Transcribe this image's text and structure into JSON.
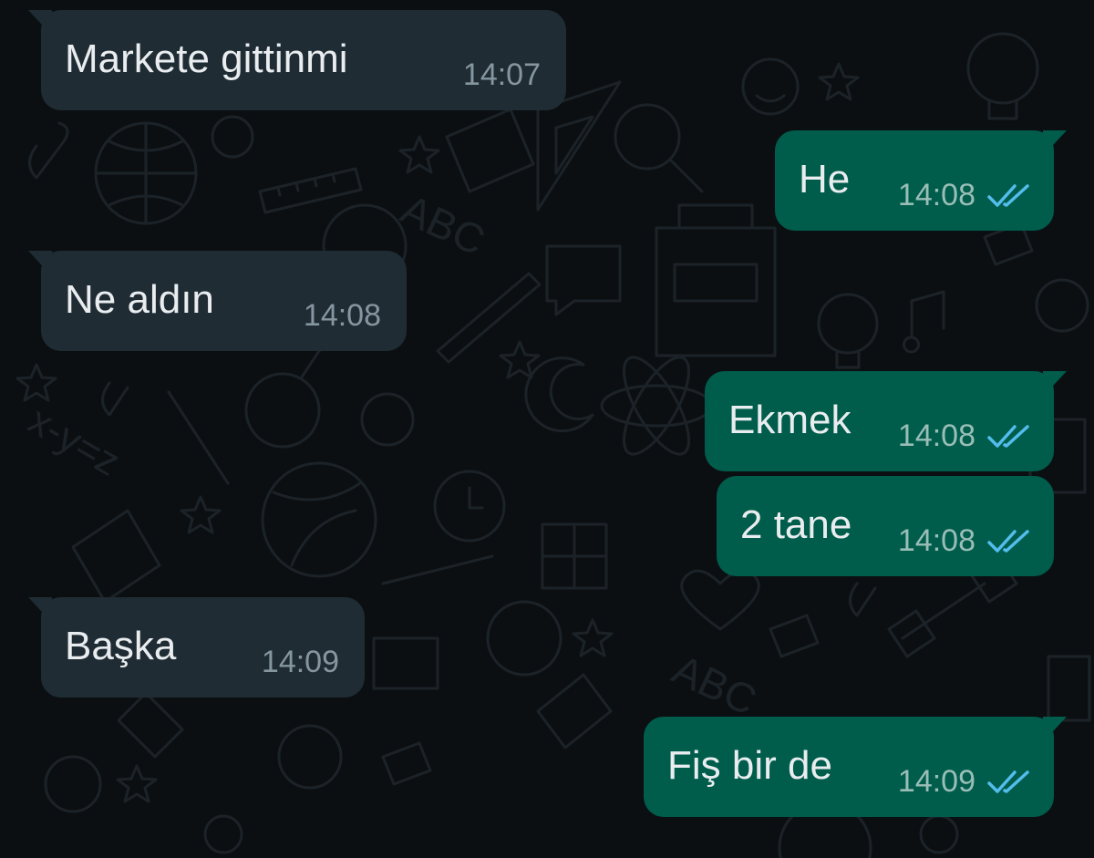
{
  "chat": {
    "messages": [
      {
        "direction": "in",
        "text": "Markete gittinmi",
        "time": "14:07"
      },
      {
        "direction": "out",
        "text": "He",
        "time": "14:08",
        "status": "read",
        "status_icon": "double-check-read-icon"
      },
      {
        "direction": "in",
        "text": "Ne aldın",
        "time": "14:08"
      },
      {
        "direction": "out",
        "text": "Ekmek",
        "time": "14:08",
        "status": "read",
        "status_icon": "double-check-read-icon"
      },
      {
        "direction": "out",
        "text": "2 tane",
        "time": "14:08",
        "status": "read",
        "status_icon": "double-check-read-icon"
      },
      {
        "direction": "in",
        "text": "Başka",
        "time": "14:09"
      },
      {
        "direction": "out",
        "text": "Fiş bir de",
        "time": "14:09",
        "status": "read",
        "status_icon": "double-check-read-icon"
      }
    ]
  },
  "theme": {
    "background": "#0b0f12",
    "incoming_bubble": "#1f2c34",
    "outgoing_bubble": "#005c4b",
    "read_tick": "#53bdeb"
  }
}
